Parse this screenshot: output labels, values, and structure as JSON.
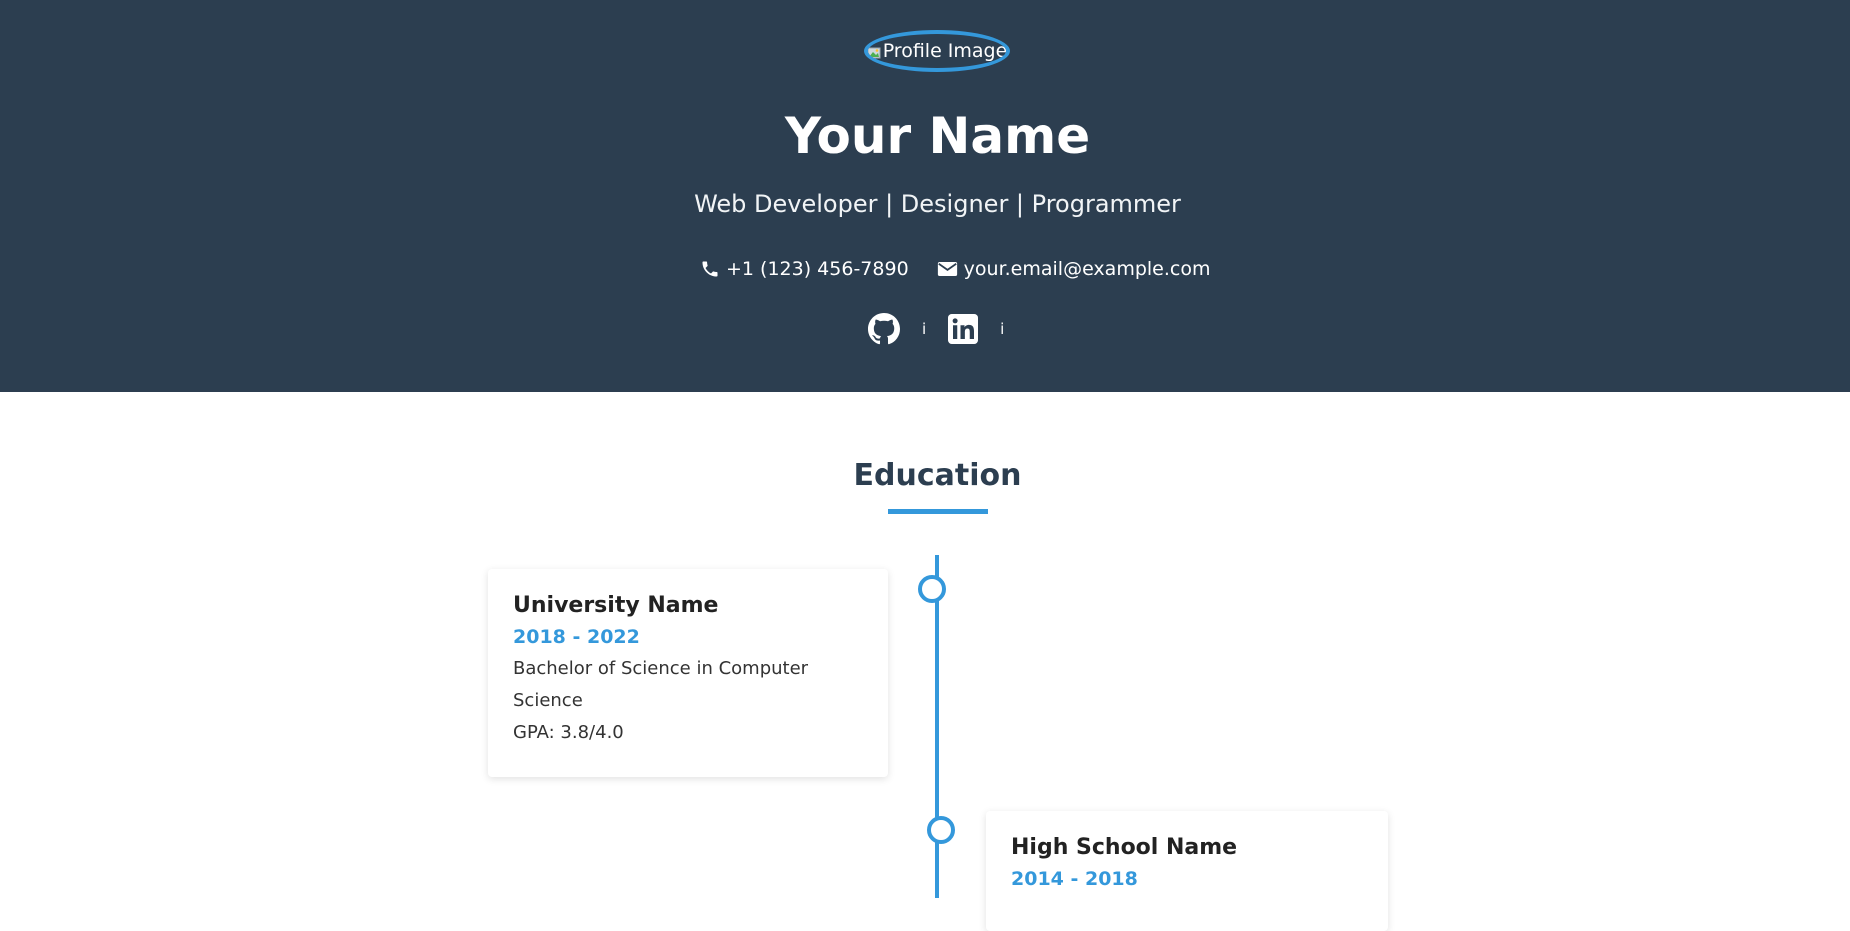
{
  "header": {
    "profile_image_alt": "Profile Image",
    "name": "Your Name",
    "tagline": "Web Developer | Designer | Programmer",
    "phone": "+1 (123) 456-7890",
    "email": "your.email@example.com",
    "social_sep_1": "i",
    "social_sep_2": "i",
    "background_color": "#2c3e50"
  },
  "education": {
    "title": "Education",
    "accent_color": "#3498db",
    "items": [
      {
        "school": "University Name",
        "dates": "2018 - 2022",
        "degree": "Bachelor of Science in Computer Science",
        "gpa": "GPA: 3.8/4.0"
      },
      {
        "school": "High School Name",
        "dates": "2014 - 2018"
      }
    ]
  },
  "icons": [
    "broken-image-icon",
    "phone-icon",
    "envelope-icon",
    "github-icon",
    "linkedin-icon"
  ]
}
